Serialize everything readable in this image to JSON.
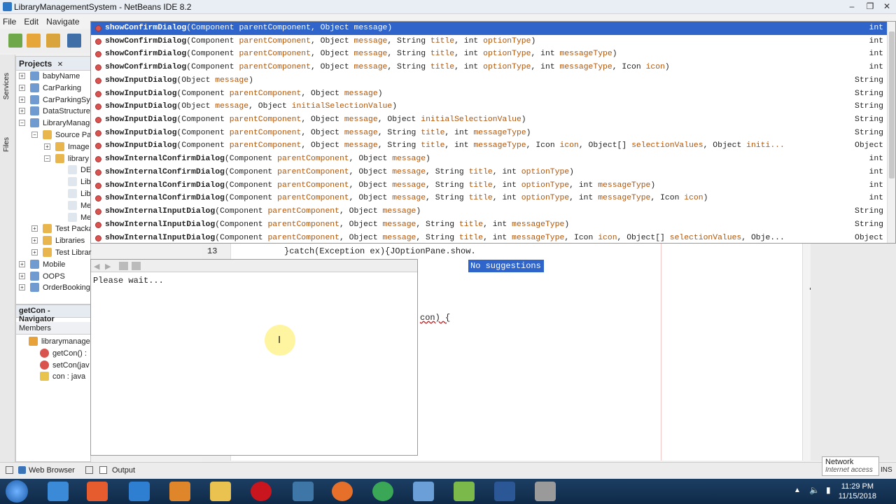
{
  "window": {
    "title": "LibraryManagementSystem - NetBeans IDE 8.2",
    "buttons": [
      "–",
      "❐",
      "✕"
    ]
  },
  "menubar": [
    "File",
    "Edit",
    "Navigate"
  ],
  "projects_panel": {
    "title": "Projects",
    "close": "✕",
    "items": [
      {
        "label": "babyName",
        "level": 0,
        "exp": "+"
      },
      {
        "label": "CarParking",
        "level": 0,
        "exp": "+"
      },
      {
        "label": "CarParkingSys",
        "level": 0,
        "exp": "+"
      },
      {
        "label": "DataStructure",
        "level": 0,
        "exp": "+"
      },
      {
        "label": "LibraryManage",
        "level": 0,
        "exp": "−"
      },
      {
        "label": "Source Pa",
        "level": 1,
        "exp": "−"
      },
      {
        "label": "Image",
        "level": 2,
        "exp": "+"
      },
      {
        "label": "library",
        "level": 2,
        "exp": "−"
      },
      {
        "label": "DE",
        "level": 3,
        "exp": ""
      },
      {
        "label": "Lib",
        "level": 3,
        "exp": ""
      },
      {
        "label": "Lib",
        "level": 3,
        "exp": ""
      },
      {
        "label": "Me",
        "level": 3,
        "exp": ""
      },
      {
        "label": "Me",
        "level": 3,
        "exp": ""
      },
      {
        "label": "Test Packa",
        "level": 1,
        "exp": "+"
      },
      {
        "label": "Libraries",
        "level": 1,
        "exp": "+"
      },
      {
        "label": "Test Libraries",
        "level": 1,
        "exp": "+"
      },
      {
        "label": "Mobile",
        "level": 0,
        "exp": "+"
      },
      {
        "label": "OOPS",
        "level": 0,
        "exp": "+"
      },
      {
        "label": "OrderBooking",
        "level": 0,
        "exp": "+"
      }
    ]
  },
  "side_tabs": [
    "Services",
    "Files"
  ],
  "navigator": {
    "title": "getCon - Navigator",
    "members_label": "Members",
    "items": [
      {
        "label": "librarymanage",
        "level": 0
      },
      {
        "label": "getCon() :",
        "level": 1
      },
      {
        "label": "setCon(jav",
        "level": 1
      },
      {
        "label": "con : java",
        "level": 1
      }
    ]
  },
  "completion": {
    "rows": [
      {
        "name": "showConfirmDialog",
        "params": [
          [
            "Component",
            "parentComponent"
          ],
          [
            "Object",
            "message"
          ]
        ],
        "ret": "int",
        "selected": true
      },
      {
        "name": "showConfirmDialog",
        "params": [
          [
            "Component",
            "parentComponent"
          ],
          [
            "Object",
            "message"
          ],
          [
            "String",
            "title"
          ],
          [
            "int",
            "optionType"
          ]
        ],
        "ret": "int"
      },
      {
        "name": "showConfirmDialog",
        "params": [
          [
            "Component",
            "parentComponent"
          ],
          [
            "Object",
            "message"
          ],
          [
            "String",
            "title"
          ],
          [
            "int",
            "optionType"
          ],
          [
            "int",
            "messageType"
          ]
        ],
        "ret": "int"
      },
      {
        "name": "showConfirmDialog",
        "params": [
          [
            "Component",
            "parentComponent"
          ],
          [
            "Object",
            "message"
          ],
          [
            "String",
            "title"
          ],
          [
            "int",
            "optionType"
          ],
          [
            "int",
            "messageType"
          ],
          [
            "Icon",
            "icon"
          ]
        ],
        "ret": "int"
      },
      {
        "name": "showInputDialog",
        "params": [
          [
            "Object",
            "message"
          ]
        ],
        "ret": "String"
      },
      {
        "name": "showInputDialog",
        "params": [
          [
            "Component",
            "parentComponent"
          ],
          [
            "Object",
            "message"
          ]
        ],
        "ret": "String"
      },
      {
        "name": "showInputDialog",
        "params": [
          [
            "Object",
            "message"
          ],
          [
            "Object",
            "initialSelectionValue"
          ]
        ],
        "ret": "String"
      },
      {
        "name": "showInputDialog",
        "params": [
          [
            "Component",
            "parentComponent"
          ],
          [
            "Object",
            "message"
          ],
          [
            "Object",
            "initialSelectionValue"
          ]
        ],
        "ret": "String"
      },
      {
        "name": "showInputDialog",
        "params": [
          [
            "Component",
            "parentComponent"
          ],
          [
            "Object",
            "message"
          ],
          [
            "String",
            "title"
          ],
          [
            "int",
            "messageType"
          ]
        ],
        "ret": "String"
      },
      {
        "name": "showInputDialog",
        "params": [
          [
            "Component",
            "parentComponent"
          ],
          [
            "Object",
            "message"
          ],
          [
            "String",
            "title"
          ],
          [
            "int",
            "messageType"
          ],
          [
            "Icon",
            "icon"
          ],
          [
            "Object[]",
            "selectionValues"
          ],
          [
            "Object",
            "initi..."
          ]
        ],
        "ret": "Object"
      },
      {
        "name": "showInternalConfirmDialog",
        "params": [
          [
            "Component",
            "parentComponent"
          ],
          [
            "Object",
            "message"
          ]
        ],
        "ret": "int"
      },
      {
        "name": "showInternalConfirmDialog",
        "params": [
          [
            "Component",
            "parentComponent"
          ],
          [
            "Object",
            "message"
          ],
          [
            "String",
            "title"
          ],
          [
            "int",
            "optionType"
          ]
        ],
        "ret": "int"
      },
      {
        "name": "showInternalConfirmDialog",
        "params": [
          [
            "Component",
            "parentComponent"
          ],
          [
            "Object",
            "message"
          ],
          [
            "String",
            "title"
          ],
          [
            "int",
            "optionType"
          ],
          [
            "int",
            "messageType"
          ]
        ],
        "ret": "int"
      },
      {
        "name": "showInternalConfirmDialog",
        "params": [
          [
            "Component",
            "parentComponent"
          ],
          [
            "Object",
            "message"
          ],
          [
            "String",
            "title"
          ],
          [
            "int",
            "optionType"
          ],
          [
            "int",
            "messageType"
          ],
          [
            "Icon",
            "icon"
          ]
        ],
        "ret": "int"
      },
      {
        "name": "showInternalInputDialog",
        "params": [
          [
            "Component",
            "parentComponent"
          ],
          [
            "Object",
            "message"
          ]
        ],
        "ret": "String"
      },
      {
        "name": "showInternalInputDialog",
        "params": [
          [
            "Component",
            "parentComponent"
          ],
          [
            "Object",
            "message"
          ],
          [
            "String",
            "title"
          ],
          [
            "int",
            "messageType"
          ]
        ],
        "ret": "String"
      },
      {
        "name": "showInternalInputDialog",
        "params": [
          [
            "Component",
            "parentComponent"
          ],
          [
            "Object",
            "message"
          ],
          [
            "String",
            "title"
          ],
          [
            "int",
            "messageType"
          ],
          [
            "Icon",
            "icon"
          ],
          [
            "Object[]",
            "selectionValues"
          ],
          [
            "Obje...",
            ""
          ]
        ],
        "ret": "Object"
      }
    ]
  },
  "editor": {
    "line_number": "13",
    "code_line": "}catch(Exception ex){JOptionPane.show.",
    "partial_code": "con) {"
  },
  "javadoc": {
    "text": "Please wait..."
  },
  "no_suggestions": "No suggestions",
  "bottom": {
    "web_browser": "Web Browser",
    "output": "Output",
    "ins": "INS"
  },
  "network_tip": {
    "title": "Network",
    "status": "Internet access"
  },
  "taskbar": {
    "time": "11:29 PM",
    "date": "11/15/2018"
  },
  "colors": {
    "selection": "#2f65ca",
    "param_name": "#b0550a",
    "method_dot": "#d9534f"
  }
}
